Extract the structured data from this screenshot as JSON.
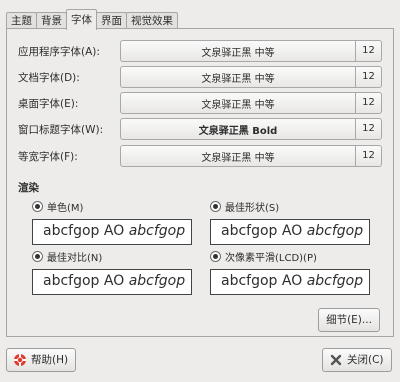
{
  "tabs": [
    "主题",
    "背景",
    "字体",
    "界面",
    "视觉效果"
  ],
  "active_tab": 2,
  "fonts": [
    {
      "label": "应用程序字体(A):",
      "name": "文泉驿正黑 中等",
      "size": "12",
      "bold": false
    },
    {
      "label": "文档字体(D):",
      "name": "文泉驿正黑 中等",
      "size": "12",
      "bold": false
    },
    {
      "label": "桌面字体(E):",
      "name": "文泉驿正黑 中等",
      "size": "12",
      "bold": false
    },
    {
      "label": "窗口标题字体(W):",
      "name": "文泉驿正黑 Bold",
      "size": "12",
      "bold": true
    },
    {
      "label": "等宽字体(F):",
      "name": "文泉驿正黑 中等",
      "size": "12",
      "bold": false
    }
  ],
  "rendering": {
    "title": "渲染",
    "options": [
      {
        "label": "单色(M)",
        "sample_plain": "abcfgop AO",
        "sample_italic": "abcfgop"
      },
      {
        "label": "最佳形状(S)",
        "sample_plain": "abcfgop AO",
        "sample_italic": "abcfgop"
      },
      {
        "label": "最佳对比(N)",
        "sample_plain": "abcfgop AO",
        "sample_italic": "abcfgop"
      },
      {
        "label": "次像素平滑(LCD)(P)",
        "sample_plain": "abcfgop AO",
        "sample_italic": "abcfgop"
      }
    ]
  },
  "details_button": "细节(E)...",
  "help_button": "帮助(H)",
  "close_button": "关闭(C)",
  "colors": {
    "help_icon": "#e23b2e",
    "close_icon": "#555555"
  }
}
